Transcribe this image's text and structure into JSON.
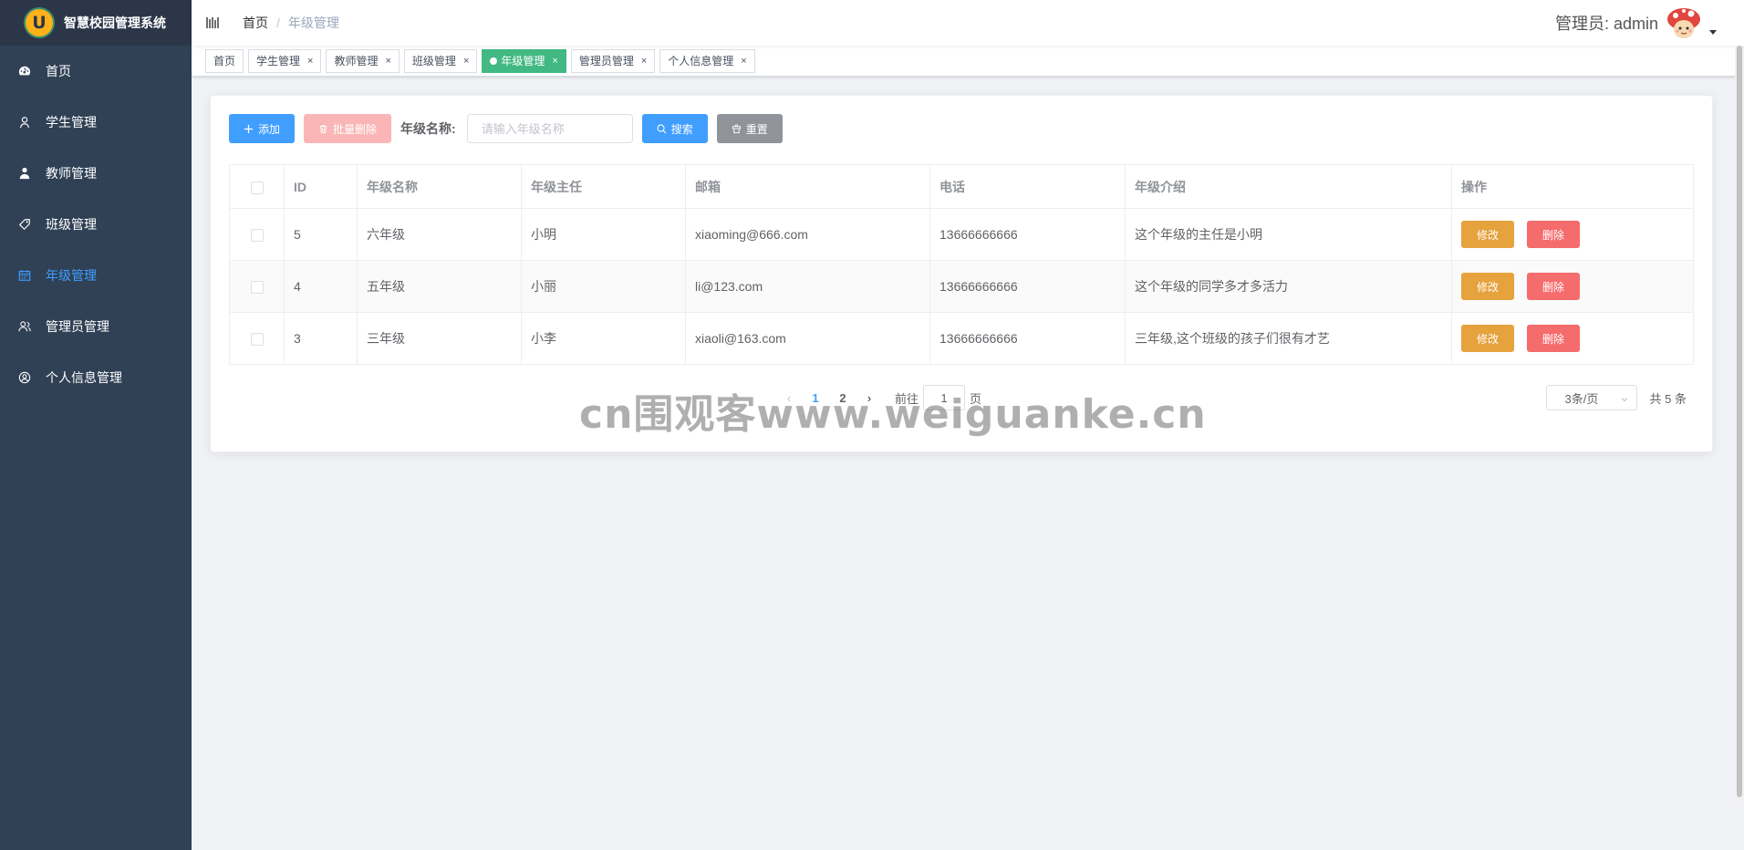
{
  "app": {
    "title": "智慧校园管理系统",
    "logo_letter": "U"
  },
  "sidebar": {
    "items": [
      {
        "label": "首页",
        "icon": "dashboard-icon",
        "active": false
      },
      {
        "label": "学生管理",
        "icon": "user-icon",
        "active": false
      },
      {
        "label": "教师管理",
        "icon": "teacher-icon",
        "active": false
      },
      {
        "label": "班级管理",
        "icon": "tag-icon",
        "active": false
      },
      {
        "label": "年级管理",
        "icon": "calendar-icon",
        "active": true
      },
      {
        "label": "管理员管理",
        "icon": "admin-icon",
        "active": false
      },
      {
        "label": "个人信息管理",
        "icon": "profile-icon",
        "active": false
      }
    ]
  },
  "navbar": {
    "breadcrumb": {
      "home": "首页",
      "separator": "/",
      "current": "年级管理"
    },
    "user_label": "管理员: admin"
  },
  "tags": [
    {
      "label": "首页",
      "closable": false,
      "active": false
    },
    {
      "label": "学生管理",
      "closable": true,
      "active": false
    },
    {
      "label": "教师管理",
      "closable": true,
      "active": false
    },
    {
      "label": "班级管理",
      "closable": true,
      "active": false
    },
    {
      "label": "年级管理",
      "closable": true,
      "active": true
    },
    {
      "label": "管理员管理",
      "closable": true,
      "active": false
    },
    {
      "label": "个人信息管理",
      "closable": true,
      "active": false
    }
  ],
  "toolbar": {
    "add_label": "添加",
    "batch_delete_label": "批量删除",
    "filter_label": "年级名称:",
    "search_placeholder": "请输入年级名称",
    "search_label": "搜索",
    "reset_label": "重置"
  },
  "table": {
    "columns": [
      "ID",
      "年级名称",
      "年级主任",
      "邮箱",
      "电话",
      "年级介绍",
      "操作"
    ],
    "rows": [
      {
        "id": "5",
        "name": "六年级",
        "director": "小明",
        "email": "xiaoming@666.com",
        "phone": "13666666666",
        "intro": "这个年级的主任是小明"
      },
      {
        "id": "4",
        "name": "五年级",
        "director": "小丽",
        "email": "li@123.com",
        "phone": "13666666666",
        "intro": "这个年级的同学多才多活力"
      },
      {
        "id": "3",
        "name": "三年级",
        "director": "小李",
        "email": "xiaoli@163.com",
        "phone": "13666666666",
        "intro": "三年级,这个班级的孩子们很有才艺"
      }
    ],
    "edit_label": "修改",
    "delete_label": "删除"
  },
  "pagination": {
    "pages": [
      "1",
      "2"
    ],
    "current_page": "1",
    "goto_prefix": "前往",
    "goto_value": "1",
    "goto_suffix": "页",
    "page_size": "3条/页",
    "total": "共 5 条"
  },
  "watermark": "cn围观客www.weiguanke.cn",
  "colors": {
    "sidebar_bg": "#304156",
    "primary": "#409eff",
    "success_tag": "#42b983",
    "warning": "#e6a23c",
    "danger": "#f56c6c"
  }
}
